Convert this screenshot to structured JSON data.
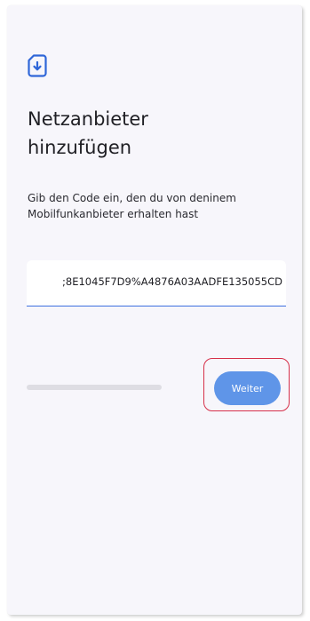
{
  "header": {
    "icon": "sim-card-download-icon",
    "title": "Netzanbieter\nhinzufügen",
    "subtitle": "Gib den Code ein, den du von deninem\nMobilfunkanbieter erhalten hast"
  },
  "code_input": {
    "value": ";8E1045F7D9%A4876A03AADFE135055CD"
  },
  "footer": {
    "next_label": "Weiter"
  },
  "colors": {
    "accent": "#3d6fe0",
    "button": "#5f95e8",
    "highlight": "#d6304a",
    "background": "#f7f6fb"
  }
}
